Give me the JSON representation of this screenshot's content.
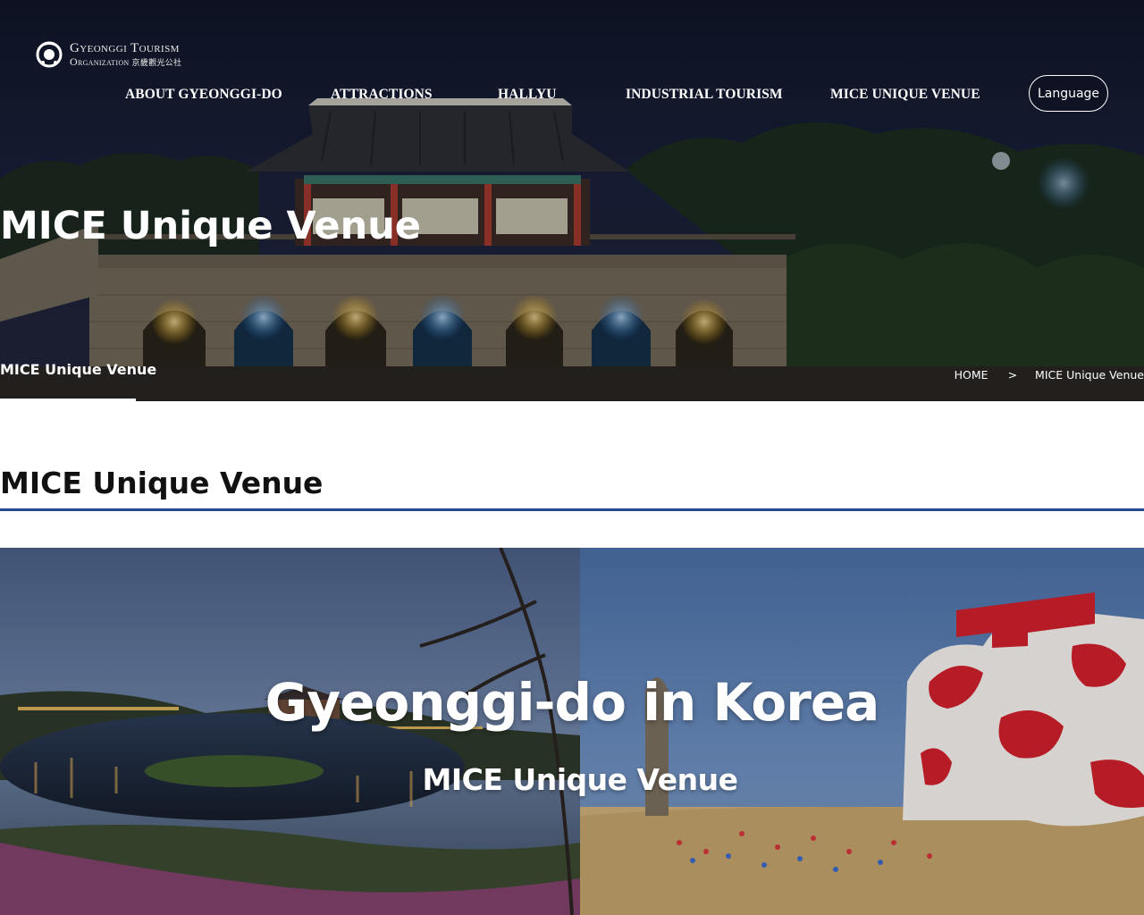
{
  "header": {
    "logo": {
      "line1": "Gyeonggi Tourism",
      "line2": "Organization",
      "hanja": "京畿觀光公社"
    },
    "nav": [
      {
        "label": "ABOUT GYEONGGI-DO"
      },
      {
        "label": "ATTRACTIONS"
      },
      {
        "label": "HALLYU"
      },
      {
        "label": "INDUSTRIAL TOURISM"
      },
      {
        "label": "MICE UNIQUE VENUE"
      }
    ],
    "language_label": "Language"
  },
  "hero": {
    "title": "MICE Unique Venue",
    "sub_tab": "MICE Unique Venue",
    "breadcrumb": {
      "home": "HOME",
      "separator": ">",
      "current": "MICE Unique Venue"
    }
  },
  "content": {
    "heading": "MICE Unique Venue",
    "banner": {
      "title": "Gyeonggi-do in Korea",
      "subtitle": "MICE Unique Venue"
    }
  },
  "colors": {
    "accent_rule": "#24478f",
    "hero_sky": "#141d33",
    "text_white": "#ffffff"
  },
  "icons": {
    "logo": "gyeonggi-tourism-logo-mark"
  }
}
